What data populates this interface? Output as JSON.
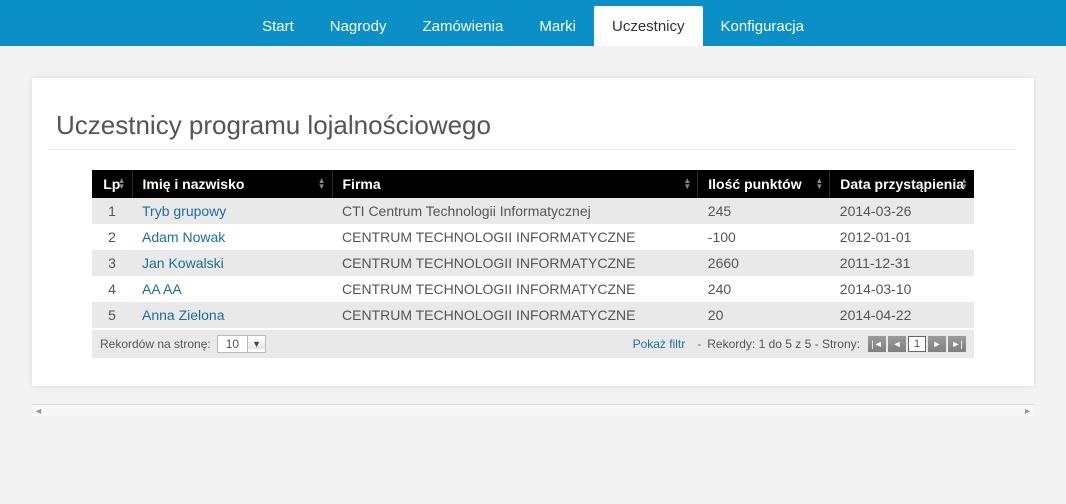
{
  "nav": {
    "items": [
      {
        "label": "Start",
        "active": false
      },
      {
        "label": "Nagrody",
        "active": false
      },
      {
        "label": "Zamówienia",
        "active": false
      },
      {
        "label": "Marki",
        "active": false
      },
      {
        "label": "Uczestnicy",
        "active": true
      },
      {
        "label": "Konfiguracja",
        "active": false
      }
    ]
  },
  "page": {
    "title": "Uczestnicy programu lojalnościowego"
  },
  "table": {
    "headers": {
      "lp": "Lp",
      "name": "Imię i nazwisko",
      "company": "Firma",
      "points": "Ilość punktów",
      "date": "Data przystąpienia"
    },
    "rows": [
      {
        "lp": "1",
        "name": "Tryb grupowy",
        "company": "CTI Centrum Technologii Informatycznej",
        "points": "245",
        "date": "2014-03-26"
      },
      {
        "lp": "2",
        "name": "Adam Nowak",
        "company": "CENTRUM TECHNOLOGII INFORMATYCZNE",
        "points": "-100",
        "date": "2012-01-01"
      },
      {
        "lp": "3",
        "name": "Jan Kowalski",
        "company": "CENTRUM TECHNOLOGII INFORMATYCZNE",
        "points": "2660",
        "date": "2011-12-31"
      },
      {
        "lp": "4",
        "name": "AA AA",
        "company": "CENTRUM TECHNOLOGII INFORMATYCZNE",
        "points": "240",
        "date": "2014-03-10"
      },
      {
        "lp": "5",
        "name": "Anna Zielona",
        "company": "CENTRUM TECHNOLOGII INFORMATYCZNE",
        "points": "20",
        "date": "2014-04-22"
      }
    ]
  },
  "footer": {
    "pagesize_label": "Rekordów na stronę:",
    "pagesize_value": "10",
    "filter_link": "Pokaż filtr",
    "records_info": "Rekordy: 1 do 5 z 5 - Strony:",
    "current_page": "1"
  }
}
